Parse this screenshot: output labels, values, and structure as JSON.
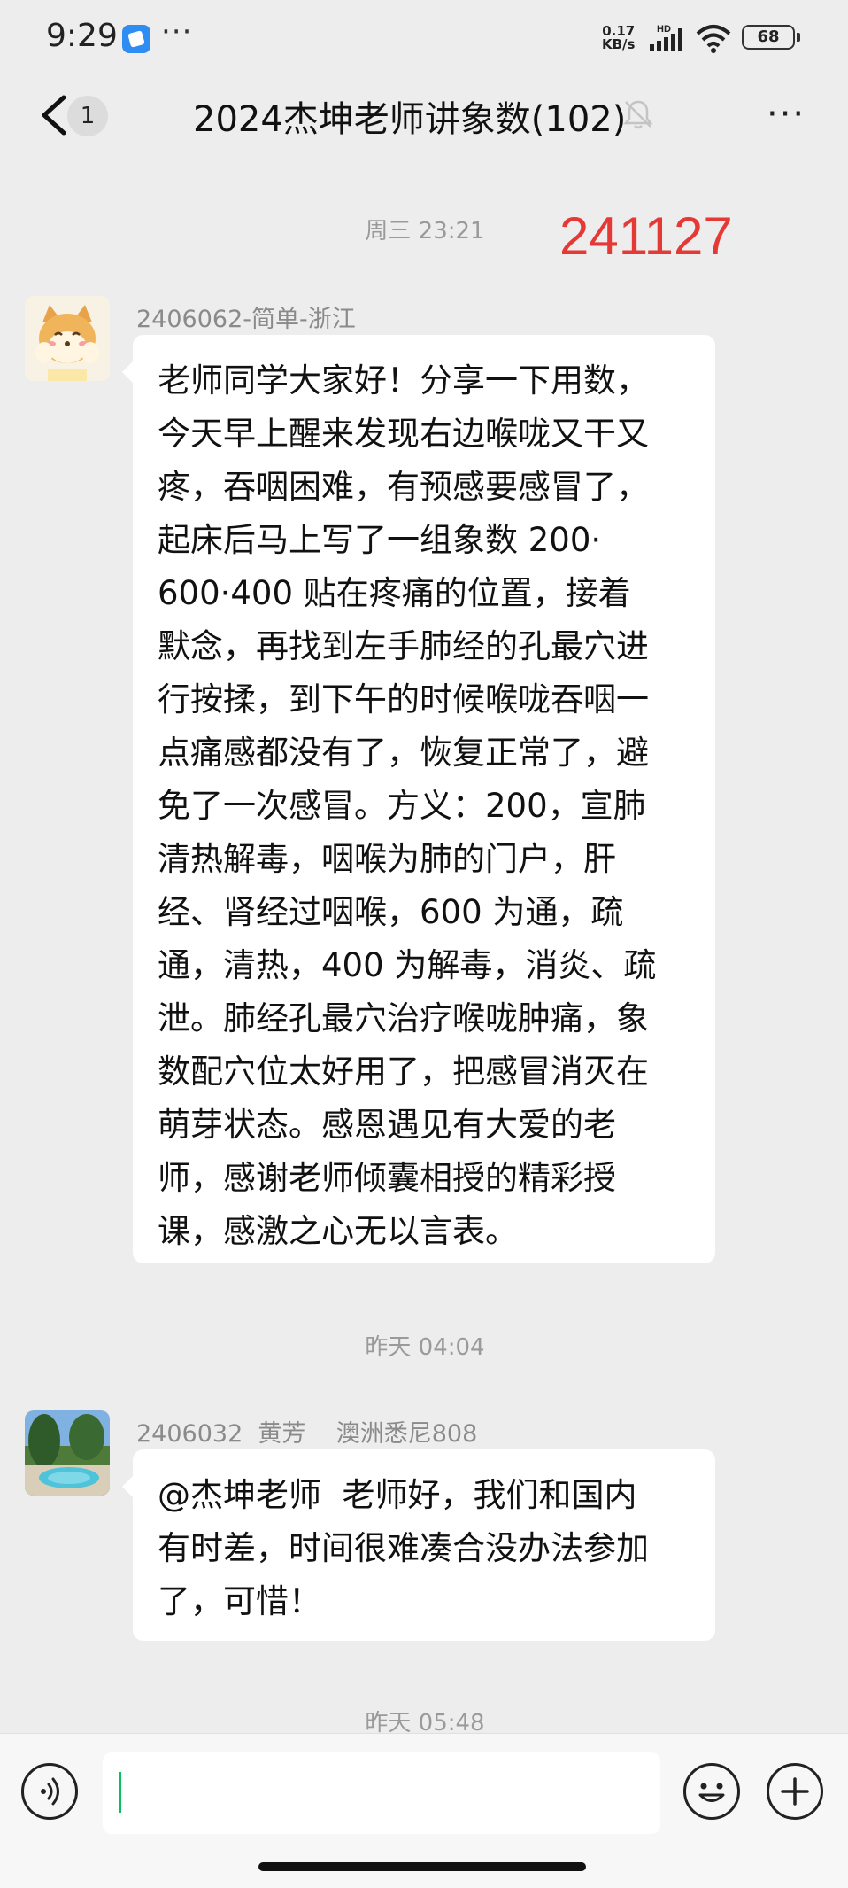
{
  "status_bar": {
    "time": "9:29",
    "more": "···",
    "net_speed_value": "0.17",
    "net_speed_unit": "KB/s",
    "network_type": "HD",
    "battery": "68"
  },
  "header": {
    "unread_count": "1",
    "title": "2024杰坤老师讲象数(102)"
  },
  "stamp": "241127",
  "messages": [
    {
      "timestamp": "周三 23:21",
      "sender": "2406062-简单-浙江",
      "avatar": "shiba-dog-avatar",
      "lines": [
        "老师同学大家好！分享一下用数，",
        "今天早上醒来发现右边喉咙又干又",
        "疼，吞咽困难，有预感要感冒了，",
        "起床后马上写了一组象数 200·",
        "600·400 贴在疼痛的位置，接着",
        "默念，再找到左手肺经的孔最穴进",
        "行按揉，到下午的时候喉咙吞咽一",
        "点痛感都没有了，恢复正常了，避",
        "免了一次感冒。方义：200，宣肺",
        "清热解毒，咽喉为肺的门户，肝",
        "经、肾经过咽喉，600 为通，疏",
        "通，清热，400 为解毒，消炎、疏",
        "泄。肺经孔最穴治疗喉咙肿痛，象",
        "数配穴位太好用了，把感冒消灭在",
        "萌芽状态。感恩遇见有大爱的老",
        "师，感谢老师倾囊相授的精彩授",
        "课，感激之心无以言表。"
      ]
    },
    {
      "timestamp": "昨天 04:04",
      "sender": "2406032  黄芳    澳洲悉尼808",
      "avatar": "pool-photo-avatar",
      "lines": [
        "@杰坤老师  老师好，我们和国内",
        "有时差，时间很难凑合没办法参加",
        "了，可惜！"
      ]
    }
  ],
  "next_timestamp": "昨天 05:48",
  "input": {
    "value": ""
  },
  "icons": [
    "back-icon",
    "mute-icon",
    "more-icon",
    "voice-icon",
    "emoji-icon",
    "plus-icon"
  ]
}
